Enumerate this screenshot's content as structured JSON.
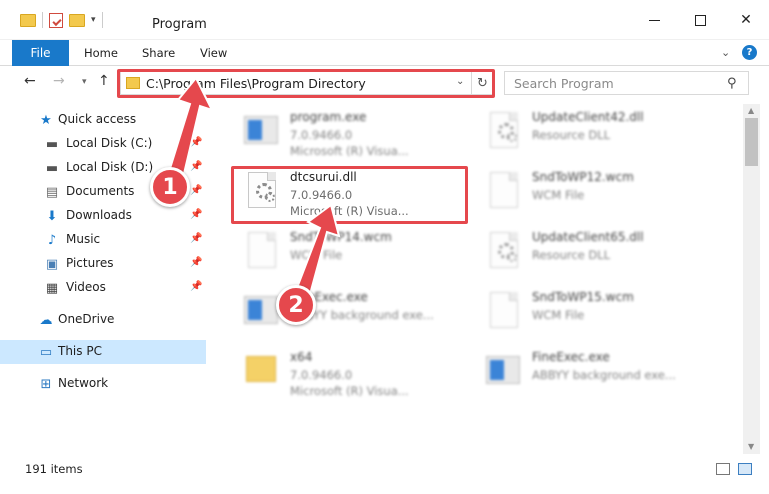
{
  "window": {
    "title": "Program"
  },
  "ribbon": {
    "file": "File",
    "home": "Home",
    "share": "Share",
    "view": "View",
    "help": "?"
  },
  "address": {
    "path": "C:\\Program Files\\Program Directory",
    "search_placeholder": "Search Program"
  },
  "nav": {
    "quick_access": "Quick access",
    "items": [
      "Local Disk (C:)",
      "Local Disk (D:)",
      "Documents",
      "Downloads",
      "Music",
      "Pictures",
      "Videos"
    ],
    "onedrive": "OneDrive",
    "this_pc": "This PC",
    "network": "Network"
  },
  "files": [
    {
      "name": "program.exe",
      "line2": "7.0.9466.0",
      "line3": "Microsoft (R) Visua..."
    },
    {
      "name": "UpdateClient42.dll",
      "line2": "Resource DLL",
      "line3": ""
    },
    {
      "name": "dtcsurui.dll",
      "line2": "7.0.9466.0",
      "line3": "Microsoft (R) Visua..."
    },
    {
      "name": "SndToWP12.wcm",
      "line2": "WCM File",
      "line3": ""
    },
    {
      "name": "SndToWP14.wcm",
      "line2": "WCM File",
      "line3": ""
    },
    {
      "name": "UpdateClient65.dll",
      "line2": "Resource DLL",
      "line3": ""
    },
    {
      "name": "FineExec.exe",
      "line2": "ABBYY background exe...",
      "line3": ""
    },
    {
      "name": "SndToWP15.wcm",
      "line2": "WCM File",
      "line3": ""
    },
    {
      "name": "x64",
      "line2": "7.0.9466.0",
      "line3": "Microsoft (R) Visua..."
    },
    {
      "name": "FineExec.exe",
      "line2": "ABBYY background exe...",
      "line3": ""
    }
  ],
  "status": {
    "count": "191 items"
  },
  "annotations": {
    "badge1": "1",
    "badge2": "2"
  },
  "colors": {
    "accent": "#1979ca",
    "highlight": "#e5484d",
    "selected": "#cce8ff"
  }
}
